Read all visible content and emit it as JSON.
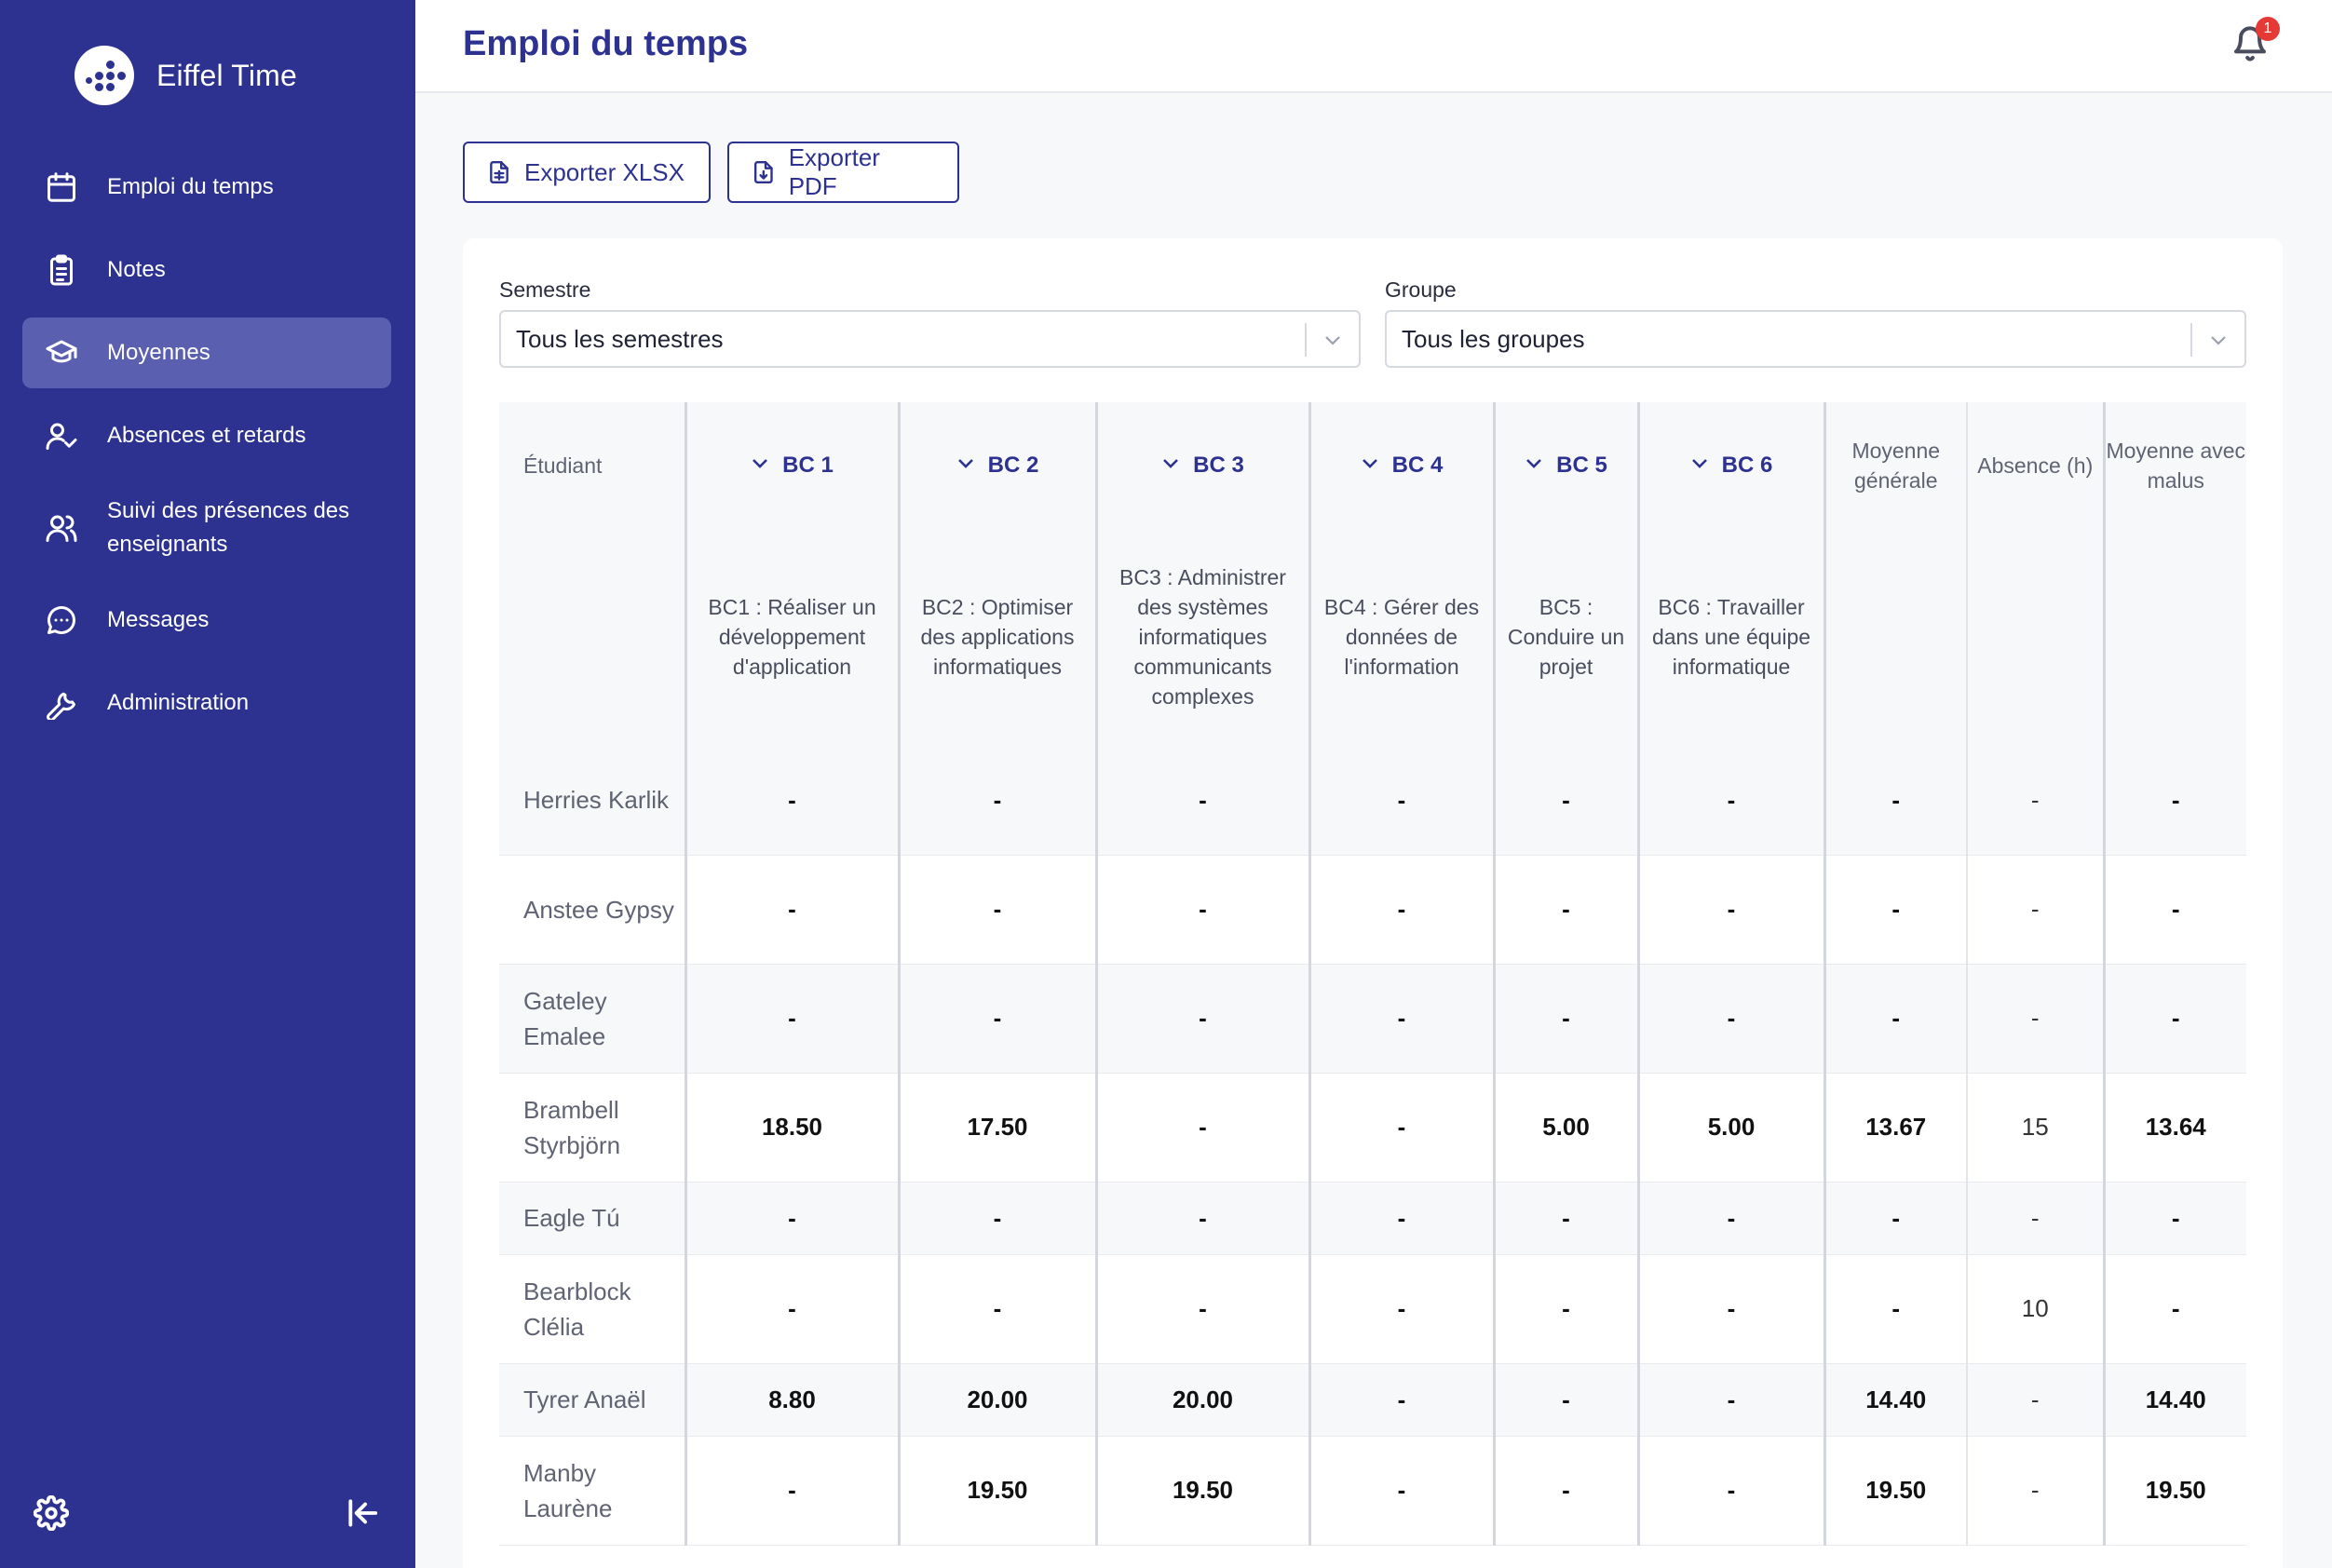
{
  "app": {
    "brand": "Eiffel Time",
    "notifications_count": "1"
  },
  "sidebar": {
    "items": [
      {
        "label": "Emploi du temps",
        "icon": "calendar-icon"
      },
      {
        "label": "Notes",
        "icon": "clipboard-icon"
      },
      {
        "label": "Moyennes",
        "icon": "graduation-cap-icon",
        "active": true
      },
      {
        "label": "Absences et retards",
        "icon": "user-check-icon"
      },
      {
        "label": "Suivi des présences des enseignants",
        "icon": "users-icon"
      },
      {
        "label": "Messages",
        "icon": "message-icon"
      },
      {
        "label": "Administration",
        "icon": "wrench-icon"
      }
    ],
    "bottom": {
      "settings": "gear-icon",
      "collapse": "collapse-left-icon"
    }
  },
  "header": {
    "title": "Emploi du temps"
  },
  "toolbar": {
    "export_xlsx": "Exporter XLSX",
    "export_pdf": "Exporter PDF"
  },
  "filters": {
    "semester_label": "Semestre",
    "semester_value": "Tous les semestres",
    "group_label": "Groupe",
    "group_value": "Tous les groupes"
  },
  "table": {
    "student_header": "Étudiant",
    "bc_headers": [
      "BC 1",
      "BC 2",
      "BC 3",
      "BC 4",
      "BC 5",
      "BC 6"
    ],
    "bc_descriptions": [
      "BC1 : Réaliser un développement d'application",
      "BC2 : Optimiser des applications informatiques",
      "BC3 : Administrer des systèmes informatiques communicants complexes",
      "BC4 : Gérer des données de l'information",
      "BC5 : Conduire un projet",
      "BC6 : Travailler dans une équipe informatique"
    ],
    "moyenne_header": "Moyenne générale",
    "absence_header": "Absence (h)",
    "malus_header": "Moyenne avec malus",
    "rows": [
      {
        "name": "Herries Karlik",
        "bc": [
          "-",
          "-",
          "-",
          "-",
          "-",
          "-"
        ],
        "moyenne": "-",
        "absence": "-",
        "malus": "-"
      },
      {
        "name": "Anstee Gypsy",
        "bc": [
          "-",
          "-",
          "-",
          "-",
          "-",
          "-"
        ],
        "moyenne": "-",
        "absence": "-",
        "malus": "-"
      },
      {
        "name": "Gateley Emalee",
        "bc": [
          "-",
          "-",
          "-",
          "-",
          "-",
          "-"
        ],
        "moyenne": "-",
        "absence": "-",
        "malus": "-"
      },
      {
        "name": "Brambell Styrbjörn",
        "bc": [
          "18.50",
          "17.50",
          "-",
          "-",
          "5.00",
          "5.00"
        ],
        "moyenne": "13.67",
        "absence": "15",
        "malus": "13.64"
      },
      {
        "name": "Eagle Tú",
        "bc": [
          "-",
          "-",
          "-",
          "-",
          "-",
          "-"
        ],
        "moyenne": "-",
        "absence": "-",
        "malus": "-"
      },
      {
        "name": "Bearblock Clélia",
        "bc": [
          "-",
          "-",
          "-",
          "-",
          "-",
          "-"
        ],
        "moyenne": "-",
        "absence": "10",
        "malus": "-"
      },
      {
        "name": "Tyrer Anaël",
        "bc": [
          "8.80",
          "20.00",
          "20.00",
          "-",
          "-",
          "-"
        ],
        "moyenne": "14.40",
        "absence": "-",
        "malus": "14.40"
      },
      {
        "name": "Manby Laurène",
        "bc": [
          "-",
          "19.50",
          "19.50",
          "-",
          "-",
          "-"
        ],
        "moyenne": "19.50",
        "absence": "-",
        "malus": "19.50"
      }
    ]
  }
}
